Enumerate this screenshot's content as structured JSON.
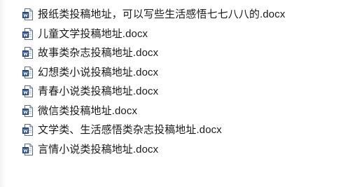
{
  "file_list": {
    "items": [
      {
        "name": "报纸类投稿地址，可以写些生活感悟七七八八的.docx",
        "icon": "word-document-icon"
      },
      {
        "name": "儿童文学投稿地址.docx",
        "icon": "word-document-icon"
      },
      {
        "name": "故事类杂志投稿地址.docx",
        "icon": "word-document-icon"
      },
      {
        "name": "幻想类小说投稿地址.docx",
        "icon": "word-document-icon"
      },
      {
        "name": "青春小说类投稿地址.docx",
        "icon": "word-document-icon"
      },
      {
        "name": "微信类投稿地址.docx",
        "icon": "word-document-icon"
      },
      {
        "name": "文学类、生活感悟类杂志投稿地址.docx",
        "icon": "word-document-icon"
      },
      {
        "name": "言情小说类投稿地址.docx",
        "icon": "word-document-icon"
      }
    ]
  },
  "colors": {
    "icon_blue": "#2b5797",
    "icon_light": "#dbe6f4",
    "text": "#1a1a1a"
  }
}
